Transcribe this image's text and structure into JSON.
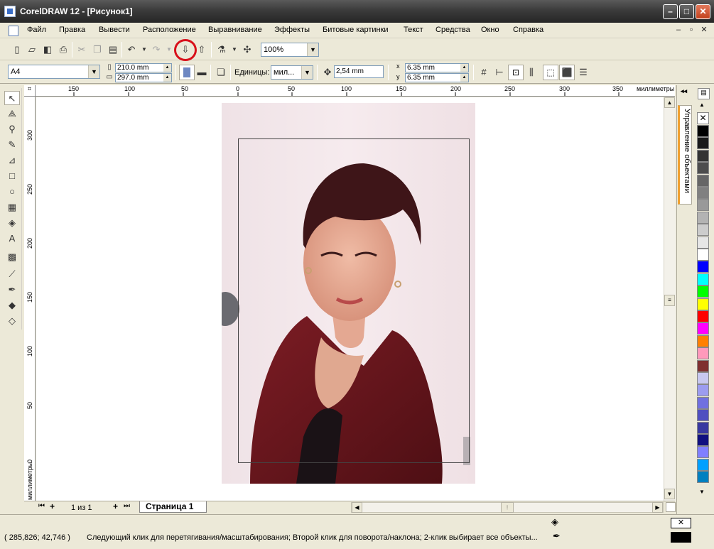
{
  "window": {
    "title": "CorelDRAW 12 - [Рисунок1]",
    "minimize": "–",
    "maximize": "□",
    "close": "✕"
  },
  "menu": [
    "Файл",
    "Правка",
    "Вывести",
    "Расположение",
    "Выравнивание",
    "Эффекты",
    "Битовые картинки",
    "Текст",
    "Средства",
    "Окно",
    "Справка"
  ],
  "mdi_controls": [
    "–",
    "▫",
    "✕"
  ],
  "toolbar": {
    "zoom": "100%",
    "icons": [
      "new-icon",
      "open-icon",
      "save-icon",
      "print-icon",
      "cut-icon",
      "copy-icon",
      "paste-icon",
      "undo-icon",
      "redo-icon",
      "import-icon",
      "export-icon",
      "application-launcher-icon",
      "corel-online-icon"
    ]
  },
  "property_bar": {
    "paper": "A4",
    "width": "210.0 mm",
    "height": "297.0 mm",
    "units_label": "Единицы:",
    "units_value": "мил...",
    "nudge": "2,54 mm",
    "dup_x": "6.35 mm",
    "dup_y": "6.35 mm",
    "dup_x_label": "x",
    "dup_y_label": "y"
  },
  "tools": [
    "pick-tool-icon",
    "shape-tool-icon",
    "zoom-tool-icon",
    "freehand-tool-icon",
    "smart-fill-tool-icon",
    "rectangle-tool-icon",
    "ellipse-tool-icon",
    "graph-paper-tool-icon",
    "basic-shapes-tool-icon",
    "text-tool-icon",
    "interactive-blend-tool-icon",
    "eyedropper-tool-icon",
    "outline-tool-icon",
    "fill-tool-icon",
    "interactive-fill-tool-icon"
  ],
  "ruler": {
    "top_labels": [
      "150",
      "100",
      "50",
      "0",
      "50",
      "100",
      "150",
      "200",
      "250",
      "300",
      "350"
    ],
    "unit": "миллиметры",
    "left_labels": [
      "300",
      "250",
      "200",
      "150",
      "100",
      "50",
      "0"
    ],
    "left_unit": "миллиметры"
  },
  "page_nav": {
    "counter": "1 из 1",
    "tab": "Страница 1"
  },
  "docker": {
    "title": "Управление объектами"
  },
  "palette": [
    "#000000",
    "#1a1a1a",
    "#333333",
    "#4d4d4d",
    "#666666",
    "#808080",
    "#999999",
    "#b3b3b3",
    "#cccccc",
    "#e6e6e6",
    "#ffffff",
    "#0000ff",
    "#00ffff",
    "#00ff00",
    "#ffff00",
    "#ff0000",
    "#ff00ff",
    "#ff8000",
    "#ff99bb",
    "#7f3030",
    "#c8c8f0",
    "#9c9cf0",
    "#7070e0",
    "#5050c0",
    "#3838a0",
    "#101080",
    "#8080ff",
    "#00a0ff",
    "#0080c0"
  ],
  "status": {
    "coords": "( 285,826; 42,746 )",
    "message": "Следующий клик для перетягивания/масштабирования; Второй клик для поворота/наклона; 2-клик выбирает все объекты..."
  },
  "highlight": {
    "color": "#d8101a"
  }
}
